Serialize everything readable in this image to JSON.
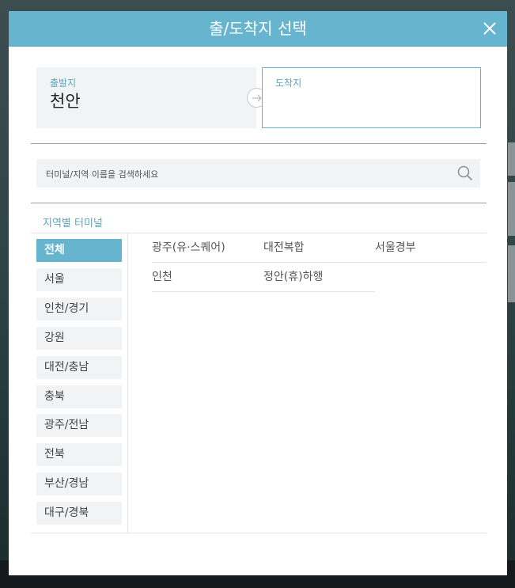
{
  "modal": {
    "title": "출/도착지 선택"
  },
  "route": {
    "departure": {
      "label": "출발지",
      "value": "천안"
    },
    "arrival": {
      "label": "도착지",
      "value": ""
    }
  },
  "search": {
    "placeholder": "터미널/지역 이름을 검색하세요"
  },
  "regions": {
    "title": "지역별 터미널",
    "items": [
      "전체",
      "서울",
      "인천/경기",
      "강원",
      "대전/충남",
      "충북",
      "광주/전남",
      "전북",
      "부산/경남",
      "대구/경북"
    ],
    "selected": "전체"
  },
  "terminals": [
    [
      "광주(유·스퀘어)",
      "대전복합",
      "서울경부"
    ],
    [
      "인천",
      "정안(휴)하행"
    ]
  ],
  "colors": {
    "accent": "#67b4cf",
    "panel": "#f2f3f4",
    "backdrop": "#2f4446"
  }
}
